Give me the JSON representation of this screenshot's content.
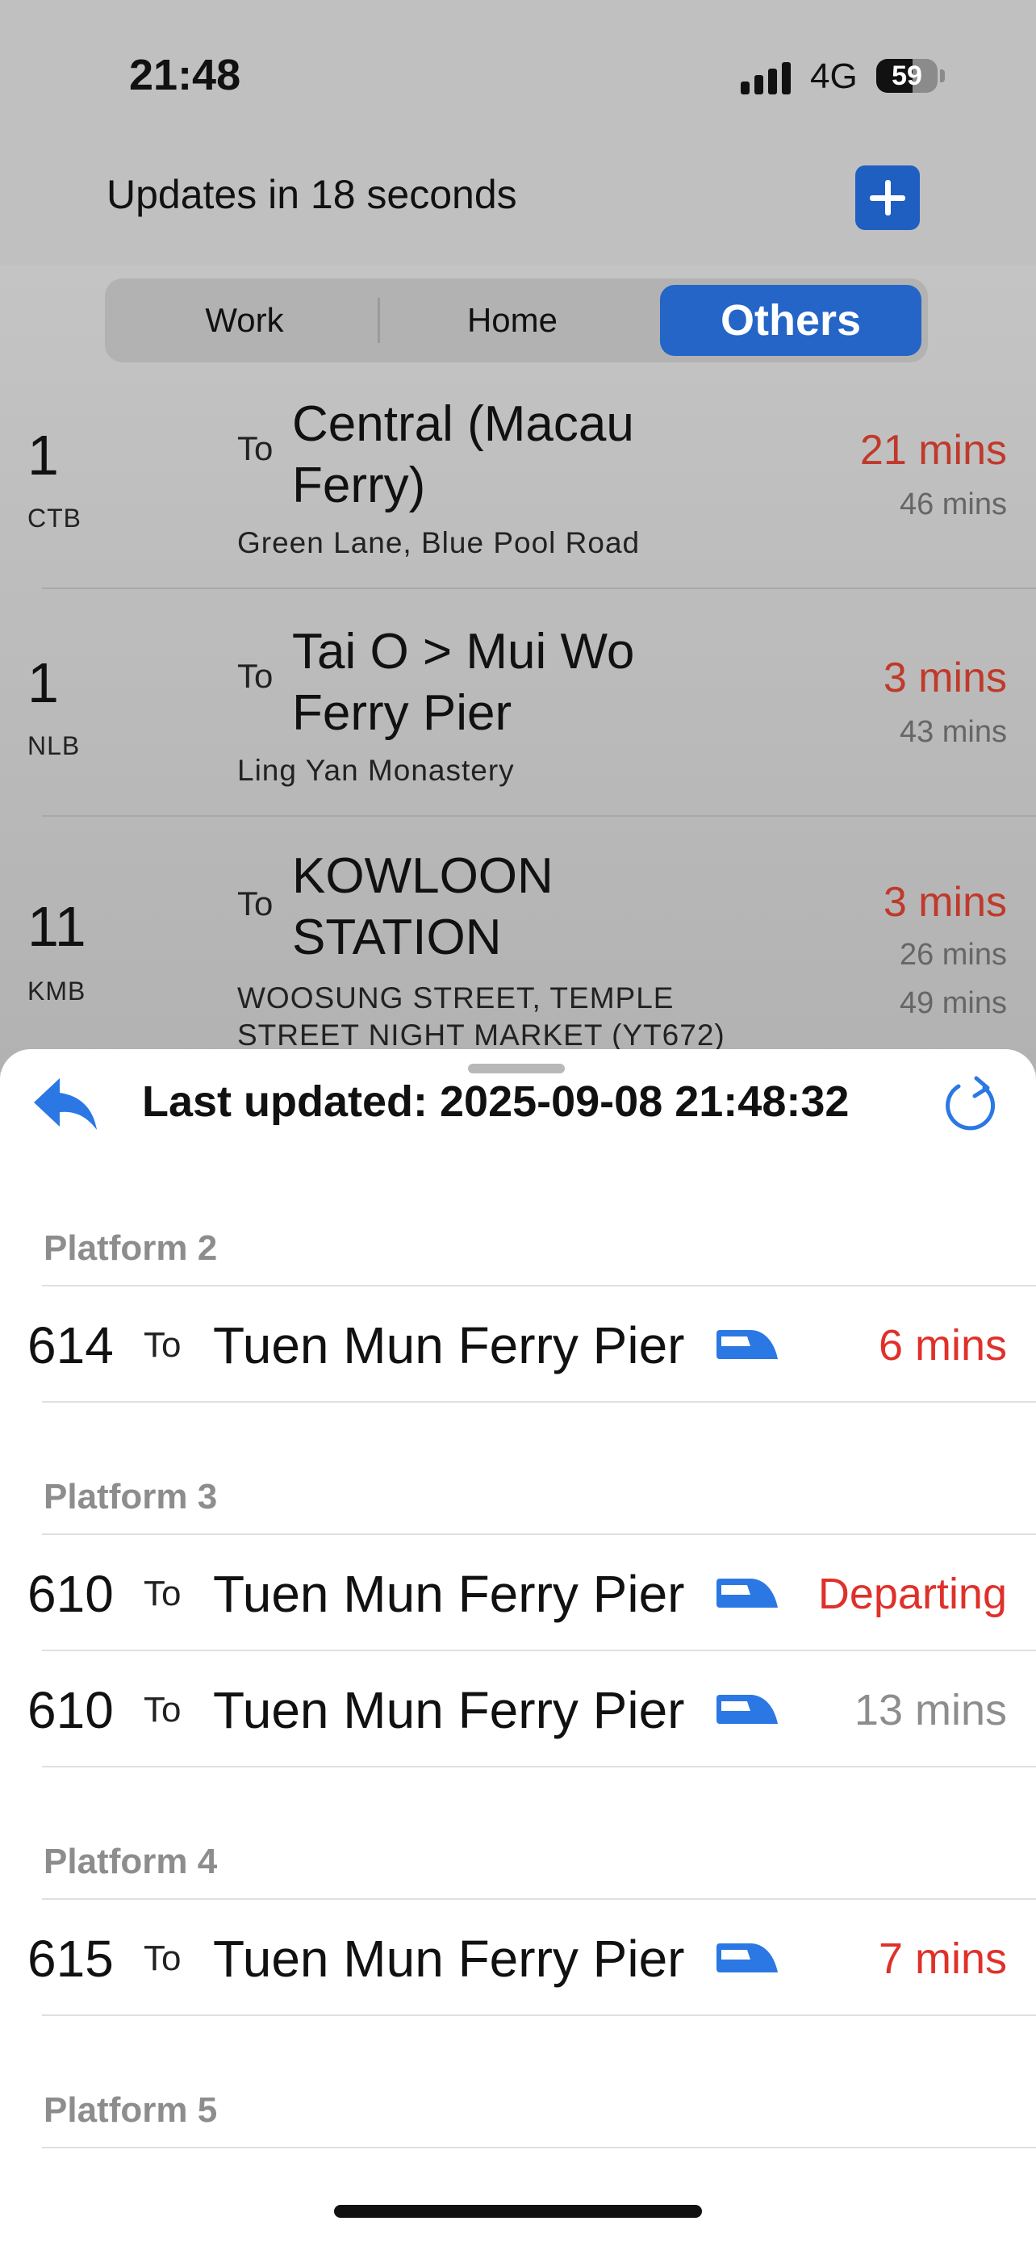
{
  "status": {
    "time": "21:48",
    "network": "4G",
    "battery": "59",
    "battery_level": 0.59
  },
  "header": {
    "updates_text": "Updates in 18 seconds"
  },
  "tabs": [
    {
      "label": "Work"
    },
    {
      "label": "Home"
    },
    {
      "label": "Others",
      "selected": true
    }
  ],
  "routes": [
    {
      "number": "1",
      "company": "CTB",
      "to": "To",
      "destination": "Central (Macau Ferry)",
      "stop": "Green Lane, Blue Pool Road",
      "eta_main": "21 mins",
      "eta_others": [
        "46 mins"
      ]
    },
    {
      "number": "1",
      "company": "NLB",
      "to": "To",
      "destination": "Tai O > Mui Wo Ferry Pier",
      "stop": "Ling Yan Monastery",
      "eta_main": "3 mins",
      "eta_others": [
        "43 mins"
      ]
    },
    {
      "number": "11",
      "company": "KMB",
      "to": "To",
      "destination": "KOWLOON STATION",
      "stop": "WOOSUNG STREET, TEMPLE STREET NIGHT MARKET (YT672)",
      "eta_main": "3 mins",
      "eta_others": [
        "26 mins",
        "49 mins"
      ]
    }
  ],
  "sheet": {
    "last_updated": "Last updated: 2025-09-08 21:48:32",
    "back_icon": "back-arrow-icon",
    "refresh_icon": "refresh-icon",
    "platforms": [
      {
        "label": "Platform 2",
        "trains": [
          {
            "number": "614",
            "to": "To",
            "destination": "Tuen Mun Ferry Pier",
            "eta": "6 mins",
            "eta_color": "red"
          }
        ]
      },
      {
        "label": "Platform 3",
        "trains": [
          {
            "number": "610",
            "to": "To",
            "destination": "Tuen Mun Ferry Pier",
            "eta": "Departing",
            "eta_color": "red"
          },
          {
            "number": "610",
            "to": "To",
            "destination": "Tuen Mun Ferry Pier",
            "eta": "13 mins",
            "eta_color": "grey"
          }
        ]
      },
      {
        "label": "Platform 4",
        "trains": [
          {
            "number": "615",
            "to": "To",
            "destination": "Tuen Mun Ferry Pier",
            "eta": "7 mins",
            "eta_color": "red"
          }
        ]
      },
      {
        "label": "Platform 5",
        "trains": []
      }
    ]
  },
  "colors": {
    "accent": "#2465c7",
    "eta_red": "#e0302a",
    "eta_grey": "#8d8d8d"
  }
}
